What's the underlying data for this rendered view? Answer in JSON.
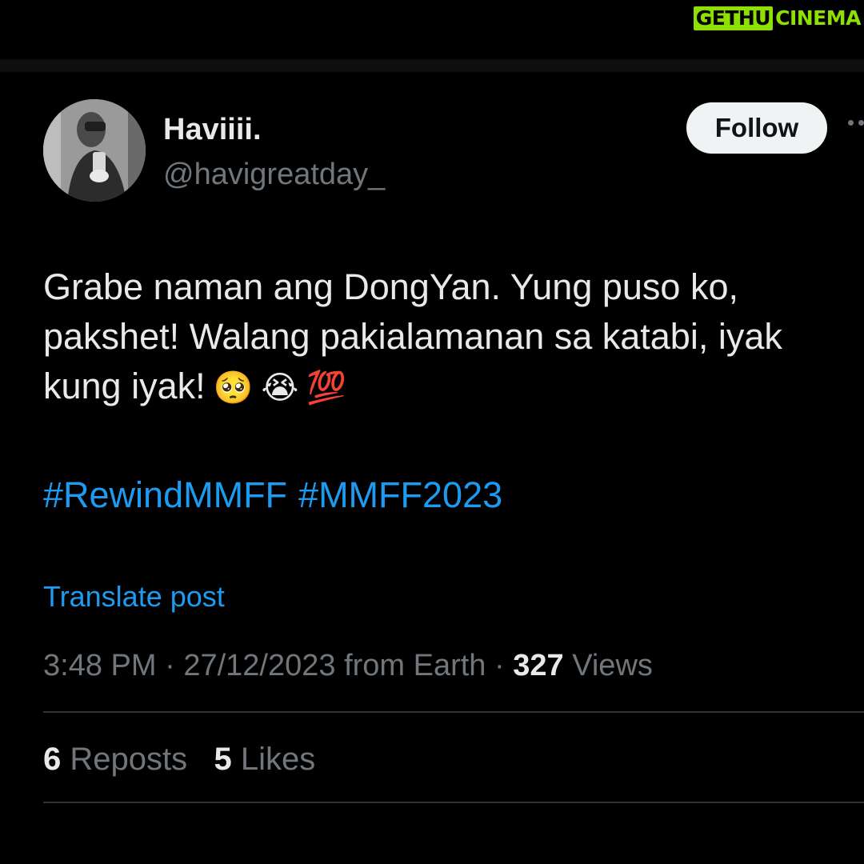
{
  "watermark": {
    "left": "GETHU",
    "right": "CINEMA",
    "accent_color": "#8ee000"
  },
  "user": {
    "display_name": "Haviiii.",
    "handle": "@havigreatday_"
  },
  "actions": {
    "follow_label": "Follow"
  },
  "tweet": {
    "text_line1": "Grabe naman ang DongYan. Yung puso ko,",
    "text_line2": "pakshet! Walang pakialamanan sa katabi, iyak",
    "text_line3": "kung iyak!",
    "emojis": [
      "🥺",
      "😭",
      "💯"
    ],
    "hashtags": [
      "#RewindMMFF",
      "#MMFF2023"
    ],
    "translate_label": "Translate post"
  },
  "meta": {
    "time": "3:48 PM",
    "separator": "·",
    "date": "27/12/2023",
    "source": "from Earth",
    "views_count": "327",
    "views_label": "Views"
  },
  "stats": {
    "reposts_count": "6",
    "reposts_label": "Reposts",
    "likes_count": "5",
    "likes_label": "Likes"
  },
  "colors": {
    "background": "#000000",
    "text": "#e7e9ea",
    "muted": "#71767b",
    "link": "#1d9bf0",
    "divider": "#2f3336"
  }
}
